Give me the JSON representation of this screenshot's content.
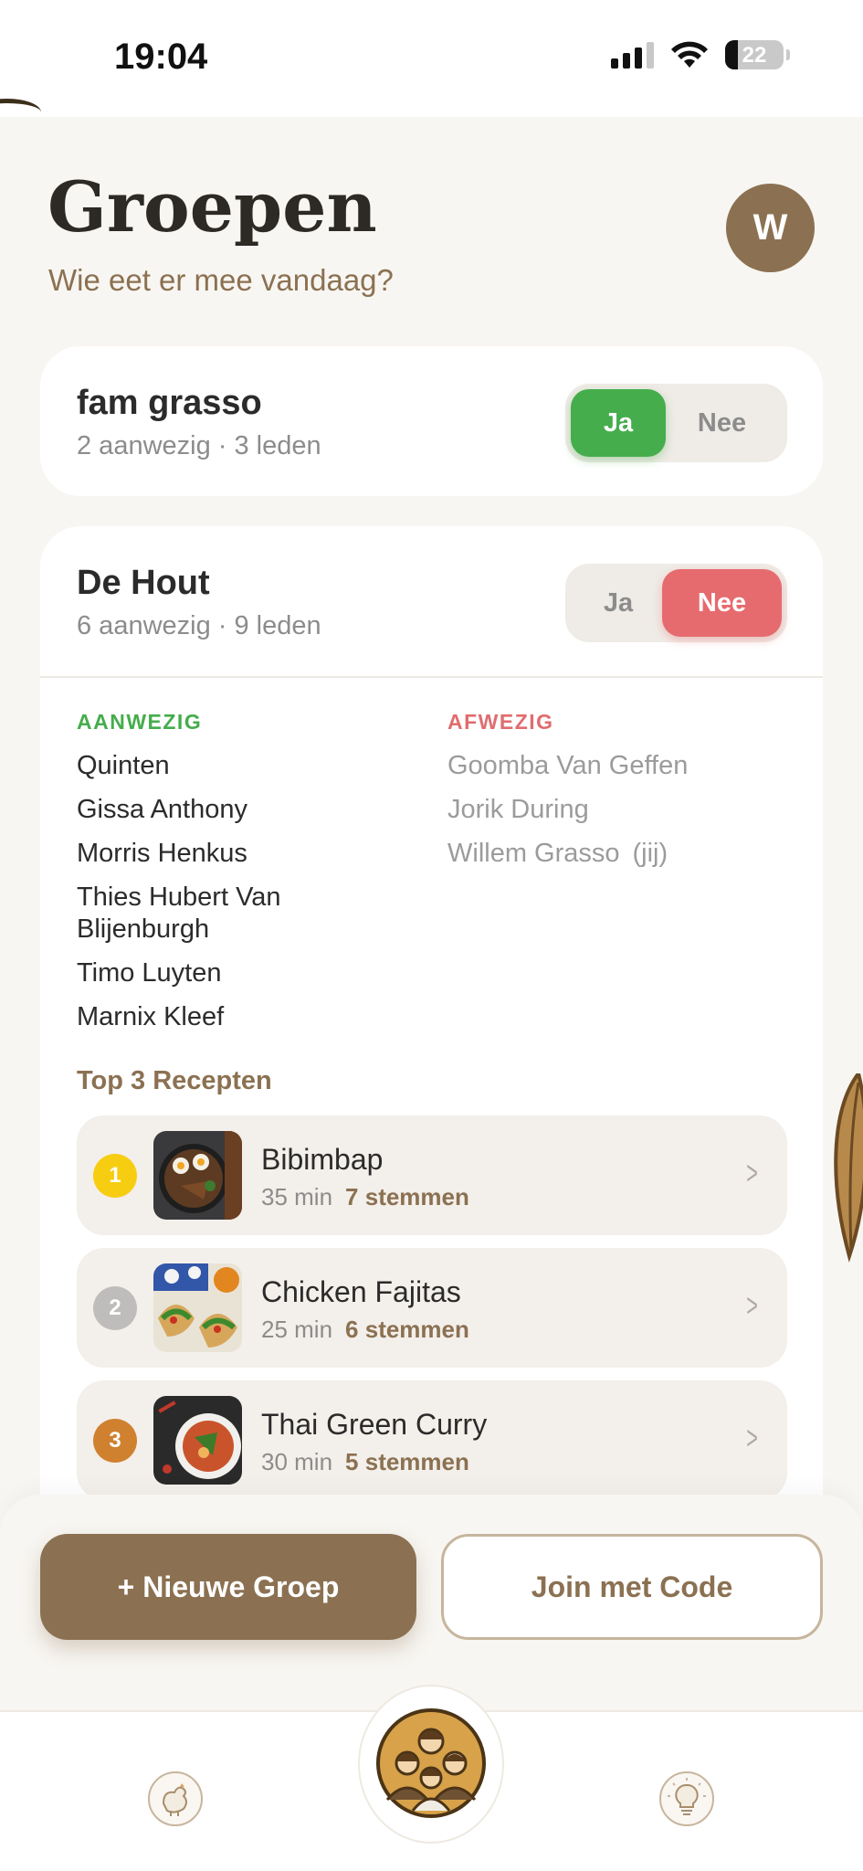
{
  "status_bar": {
    "time": "19:04",
    "battery_level": "22",
    "icons": [
      "signal-icon",
      "wifi-icon",
      "battery-icon"
    ]
  },
  "header": {
    "title": "Groepen",
    "subtitle": "Wie eet er mee vandaag?",
    "avatar_initial": "W"
  },
  "groups": [
    {
      "name": "fam grasso",
      "meta": "2 aanwezig · 3 leden",
      "toggle": {
        "yes_label": "Ja",
        "no_label": "Nee",
        "selected": "Ja"
      }
    },
    {
      "name": "De Hout",
      "meta": "6 aanwezig · 9 leden",
      "toggle": {
        "yes_label": "Ja",
        "no_label": "Nee",
        "selected": "Nee"
      },
      "present_heading": "AANWEZIG",
      "absent_heading": "AFWEZIG",
      "present": [
        "Quinten",
        "Gissa Anthony",
        "Morris Henkus",
        "Thies Hubert Van Blijenburgh",
        "Timo Luyten",
        "Marnix Kleef"
      ],
      "absent": [
        "Goomba Van Geffen",
        "Jorik During",
        "Willem Grasso"
      ],
      "you_label": "(jij)",
      "top_title": "Top 3 Recepten",
      "recipes": [
        {
          "rank": "1",
          "name": "Bibimbap",
          "time": "35 min",
          "votes": "7 stemmen"
        },
        {
          "rank": "2",
          "name": "Chicken Fajitas",
          "time": "25 min",
          "votes": "6 stemmen"
        },
        {
          "rank": "3",
          "name": "Thai Green Curry",
          "time": "30 min",
          "votes": "5 stemmen"
        }
      ]
    }
  ],
  "actions": {
    "new_group": "+ Nieuwe Groep",
    "join_code": "Join met Code"
  },
  "tab_bar": {
    "items": [
      "chicken-icon",
      "group-icon",
      "lightbulb-icon"
    ],
    "active": "group-icon"
  },
  "colors": {
    "accent": "#8b7152",
    "yes_green": "#45ad4c",
    "no_red": "#e66b6e",
    "rank_gold": "#f7cd11",
    "rank_silver": "#bfbdbb",
    "rank_bronze": "#d0812f"
  }
}
